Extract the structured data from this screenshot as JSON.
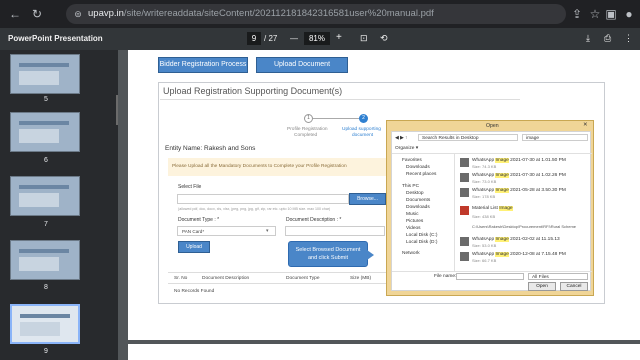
{
  "browser": {
    "url_host": "upavp.in",
    "url_path": "/site/writereaddata/siteContent/202112181842316581user%20manual.pdf"
  },
  "pdf_toolbar": {
    "title": "PowerPoint Presentation",
    "page_current": "9",
    "page_total": "/ 27",
    "zoom": "81%",
    "minus": "—",
    "plus": "+"
  },
  "sidebar": {
    "thumbs": [
      {
        "label": "5"
      },
      {
        "label": "6"
      },
      {
        "label": "7"
      },
      {
        "label": "8"
      },
      {
        "label": "9"
      }
    ]
  },
  "page": {
    "btn_bidder": "Bidder Registration Process",
    "btn_upload_doc": "Upload Document",
    "heading": "Upload Registration Supporting Document(s)",
    "step1_num": "1",
    "step1_label_1": "Profile Registration",
    "step1_label_2": "Completed",
    "step2_num": "2",
    "step2_label_1": "Upload supporting",
    "step2_label_2": "document",
    "entity_name": "Entity Name: Rakesh and Sons",
    "notice": "Please Upload all the Mandatory Documents to Complete your Profile Registration",
    "select_file": "Select File",
    "browse": "Browse...",
    "file_hint": "(allowed pdf, doc, docx, xls, xlsx, jpeg, png, jpg, gif, zip, rar etc. upto 10 MB size. max 100 char)",
    "doc_type_label": "Document Type : *",
    "doc_desc_label": "Document Description : *",
    "doc_type_value": "PAN Card*",
    "upload_btn": "Upload",
    "table_headers": [
      "Sr. No",
      "Document Description",
      "Document Type",
      "Size (MB)"
    ],
    "no_records": "No Records Found"
  },
  "callout": {
    "line1": "Select Browsed Document",
    "line2": "and click Submit"
  },
  "dialog": {
    "title": "Open",
    "search_placeholder": "Search Results in Desktop",
    "search_term": "image",
    "organize": "Organize ▾",
    "nav": [
      "Favorites",
      "Downloads",
      "Recent places",
      "This PC",
      "Desktop",
      "Documents",
      "Downloads",
      "Music",
      "Pictures",
      "Videos",
      "Local Disk (C:)",
      "Local Disk (D:)",
      "Network"
    ],
    "files": [
      {
        "pre": "WhatsApp ",
        "hl": "Image",
        "post": " 2021-07-30 at 1.01.50 PM",
        "size": "Size: 74.3 KB"
      },
      {
        "pre": "WhatsApp ",
        "hl": "Image",
        "post": " 2021-07-30 at 1.02.26 PM",
        "size": "Size: 73.0 KB"
      },
      {
        "pre": "WhatsApp ",
        "hl": "Image",
        "post": " 2021-05-28 at 3.50.30 PM",
        "size": "Size: 178 KB"
      },
      {
        "pre": "Material List ",
        "hl": "Image",
        "post": "",
        "size": "Size: 438 KB"
      },
      {
        "pre": "C:\\Users\\Rakesh\\Desktop\\Procurement\\RFI\\Rural Scheme",
        "hl": "",
        "post": "",
        "size": ""
      },
      {
        "pre": "WhatsApp ",
        "hl": "Image",
        "post": " 2021-02-02 at 11.15.13",
        "size": "Size: 53.0 KB"
      },
      {
        "pre": "WhatsApp ",
        "hl": "Image",
        "post": " 2020-12-08 at 7.15.48 PM",
        "size": "Size: 66.7 KB"
      }
    ],
    "filename_label": "File name:",
    "filetype": "All Files",
    "open_btn": "Open",
    "cancel_btn": "Cancel"
  }
}
